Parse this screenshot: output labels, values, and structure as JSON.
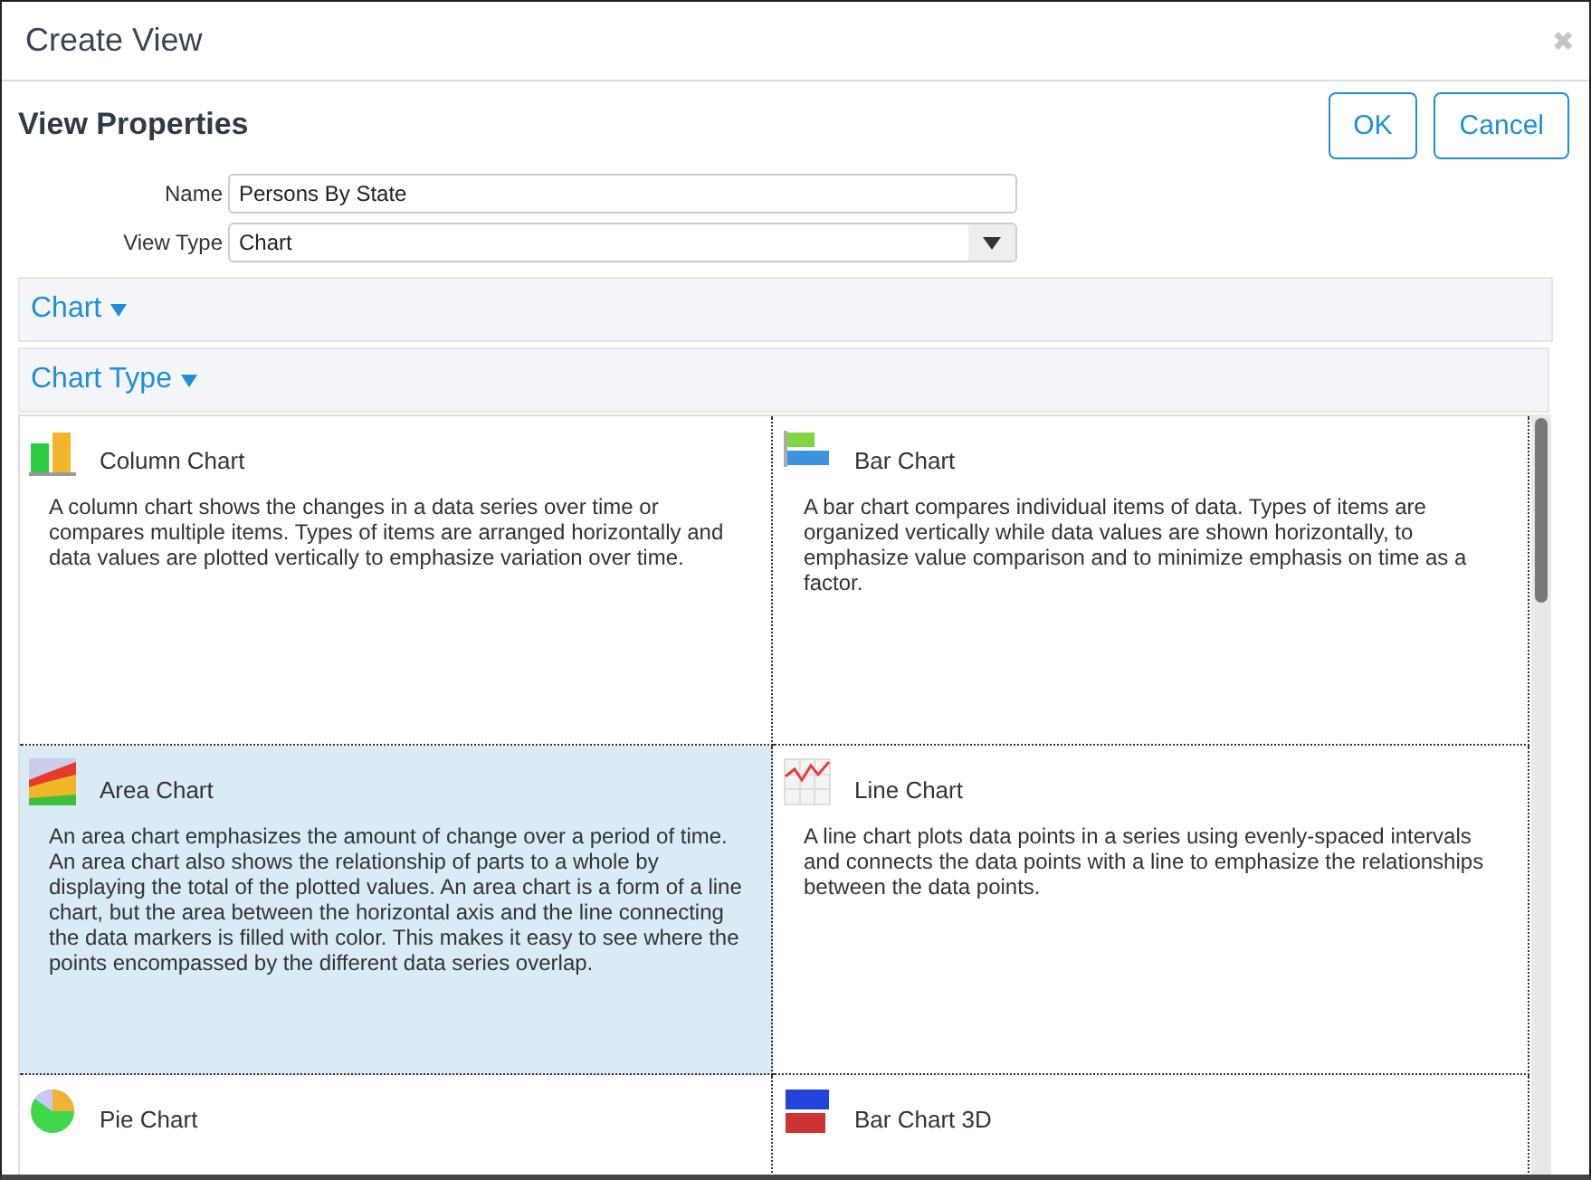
{
  "window": {
    "title": "Create View",
    "close": "✖"
  },
  "header": {
    "title": "View Properties",
    "buttons": [
      "OK",
      "Cancel"
    ]
  },
  "form": {
    "fields": [
      {
        "label": "Name",
        "kind": "text",
        "value": "Persons By State"
      },
      {
        "label": "View Type",
        "kind": "select",
        "value": "Chart"
      }
    ]
  },
  "sections": [
    {
      "label": "Chart",
      "expanded": true
    },
    {
      "label": "Chart Type",
      "expanded": true
    }
  ],
  "chart_types": [
    {
      "kind": "column",
      "name": "Column Chart",
      "selected": false,
      "description": "A column chart shows the changes in a data series over time or compares multiple items. Types of items are arranged horizontally and data values are plotted vertically to emphasize variation over time."
    },
    {
      "kind": "bar",
      "name": "Bar Chart",
      "selected": false,
      "description": "A bar chart compares individual items of data. Types of items are organized vertically while data values are shown horizontally, to emphasize value comparison and to minimize emphasis on time as a factor."
    },
    {
      "kind": "area",
      "name": "Area Chart",
      "selected": true,
      "description": "An area chart emphasizes the amount of change over a period of time. An area chart also shows the relationship of parts to a whole by displaying the total of the plotted values. An area chart is a form of a line chart, but the area between the horizontal axis and the line connecting the data markers is filled with color. This makes it easy to see where the points encompassed by the different data series overlap."
    },
    {
      "kind": "line",
      "name": "Line Chart",
      "selected": false,
      "description": "A line chart plots data points in a series using evenly-spaced intervals and connects the data points with a line to emphasize the relationships between the data points."
    },
    {
      "kind": "pie",
      "name": "Pie Chart",
      "selected": false
    },
    {
      "kind": "bar3d",
      "name": "Bar Chart 3D",
      "selected": false
    }
  ]
}
